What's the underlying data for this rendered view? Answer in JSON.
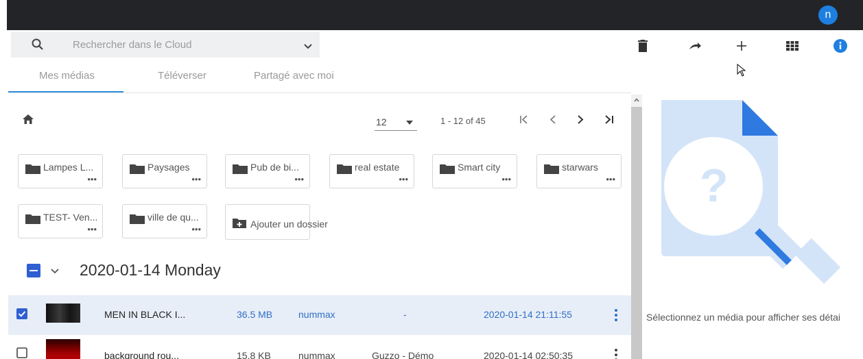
{
  "header": {
    "avatar_initial": "n",
    "accent": "#1e7fe0"
  },
  "search": {
    "placeholder": "Rechercher dans le Cloud"
  },
  "toolbar": {
    "icons": [
      "delete-icon",
      "share-icon",
      "add-icon",
      "grid-view-icon",
      "info-icon"
    ]
  },
  "tabs": [
    {
      "label": "Mes médias",
      "active": true
    },
    {
      "label": "Téléverser",
      "active": false
    },
    {
      "label": "Partagé avec moi",
      "active": false
    }
  ],
  "pagination": {
    "per_page": "12",
    "range": "1 - 12 of 45"
  },
  "folders": [
    {
      "name": "Lampes L..."
    },
    {
      "name": "Paysages"
    },
    {
      "name": "Pub de bi..."
    },
    {
      "name": "real estate"
    },
    {
      "name": "Smart city"
    },
    {
      "name": "starwars"
    },
    {
      "name": "TEST- Ven..."
    },
    {
      "name": "ville de qu..."
    }
  ],
  "folder_menu": "•••",
  "add_folder_label": "Ajouter un dossier",
  "date_group": "2020-01-14 Monday",
  "files": [
    {
      "name": "MEN IN BLACK I...",
      "size": "36.5 MB",
      "owner": "nummax",
      "project": "-",
      "date": "2020-01-14 21:11:55",
      "selected": true
    },
    {
      "name": "background rou...",
      "size": "15.8 KB",
      "owner": "nummax",
      "project": "Guzzo - Démo",
      "date": "2020-01-14 02:50:35",
      "selected": false
    }
  ],
  "details_panel": {
    "empty_text": "Sélectionnez un média pour afficher ses détai"
  },
  "colors": {
    "topbar": "#222428",
    "selected_row": "#e8eef8",
    "link_blue": "#2f6fc4",
    "check_blue": "#2f5fd0"
  }
}
